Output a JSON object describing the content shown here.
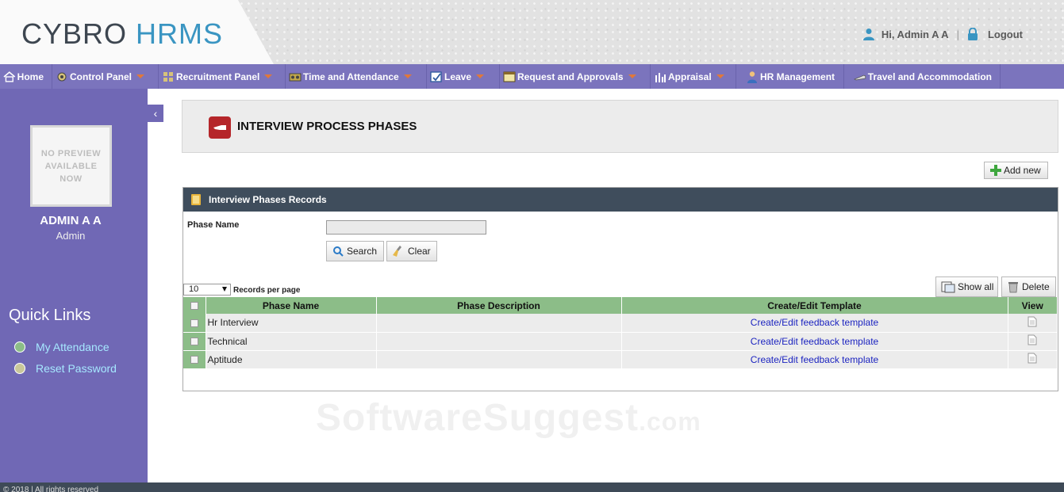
{
  "header": {
    "logo_part1": "CYBRO",
    "logo_part2": "HRMS",
    "greeting": "Hi, Admin A A",
    "separator": "|",
    "logout": "Logout"
  },
  "nav": {
    "home": "Home",
    "control_panel": "Control Panel",
    "recruitment_panel": "Recruitment Panel",
    "time_attendance": "Time and Attendance",
    "leave": "Leave",
    "requests": "Request and Approvals",
    "appraisal": "Appraisal",
    "hr_management": "HR Management",
    "travel": "Travel and Accommodation"
  },
  "sidebar": {
    "avatar_text": "NO PREVIEW AVAILABLE NOW",
    "user_name": "ADMIN A A",
    "user_role": "Admin",
    "quick_links_title": "Quick Links",
    "links": [
      {
        "label": "My Attendance",
        "dot_color": "#8cbd88"
      },
      {
        "label": "Reset Password",
        "dot_color": "#c9c79a"
      }
    ]
  },
  "page": {
    "title": "INTERVIEW PROCESS PHASES",
    "add_new": "Add new",
    "records_title": "Interview Phases Records",
    "filter": {
      "phase_name_label": "Phase Name",
      "phase_name_value": "",
      "search": "Search",
      "clear": "Clear"
    },
    "records_per_page_value": "10",
    "records_per_page_label": "Records per page",
    "show_all": "Show all",
    "delete": "Delete"
  },
  "table": {
    "columns": [
      "Phase Name",
      "Phase Description",
      "Create/Edit Template",
      "View"
    ],
    "rows": [
      {
        "name": "Hr Interview",
        "description": "",
        "template": "Create/Edit feedback template"
      },
      {
        "name": "Technical",
        "description": "",
        "template": "Create/Edit feedback template"
      },
      {
        "name": "Aptitude",
        "description": "",
        "template": "Create/Edit feedback template"
      }
    ]
  },
  "footer": {
    "text": "© 2018 | All rights reserved"
  },
  "watermark": {
    "main": "SoftwareSuggest",
    "suffix": ".com"
  },
  "colors": {
    "nav_bg": "#7b74bd",
    "sidebar_bg": "#7068b5",
    "table_header": "#8cbd88",
    "records_header": "#3f4d5c",
    "link": "#1c24c0",
    "brand_blue": "#3a95c2"
  }
}
